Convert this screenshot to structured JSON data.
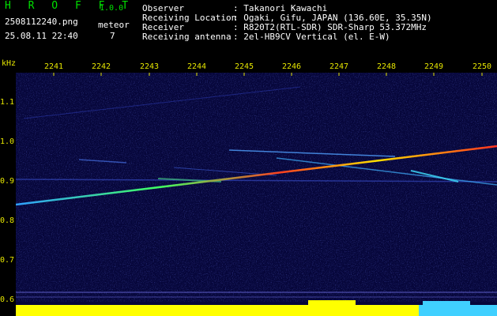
{
  "header": {
    "app_title": "H R O F F T",
    "version": "1.0.0",
    "filename": "2508112240.png",
    "datetime": "25.08.11 22:40",
    "meteor_label": "meteor",
    "meteor_count": "7"
  },
  "info": [
    {
      "key": "Observer",
      "value": ": Takanori Kawachi"
    },
    {
      "key": "Receiving Location",
      "value": ": Ogaki, Gifu, JAPAN (136.60E, 35.35N)"
    },
    {
      "key": "Receiver",
      "value": ": R820T2(RTL-SDR) SDR-Sharp 53.372MHz"
    },
    {
      "key": "Receiving antenna",
      "value": ": 2el-HB9CV Vertical (el. E-W)"
    }
  ],
  "axis": {
    "y_unit": "kHz",
    "y_ticks": [
      "1.1",
      "1.0",
      "0.9",
      "0.8",
      "0.7",
      "0.6"
    ],
    "x_ticks": [
      "2241",
      "2242",
      "2243",
      "2244",
      "2245",
      "2246",
      "2247",
      "2248",
      "2249",
      "2250"
    ]
  },
  "colors": {
    "background": "#000000",
    "spectrum_bg": "#06063a",
    "header_green": "#00e000",
    "axis_yellow": "#e6e600",
    "level_yellow": "#ffff00",
    "level_cyan": "#40d0ff"
  }
}
